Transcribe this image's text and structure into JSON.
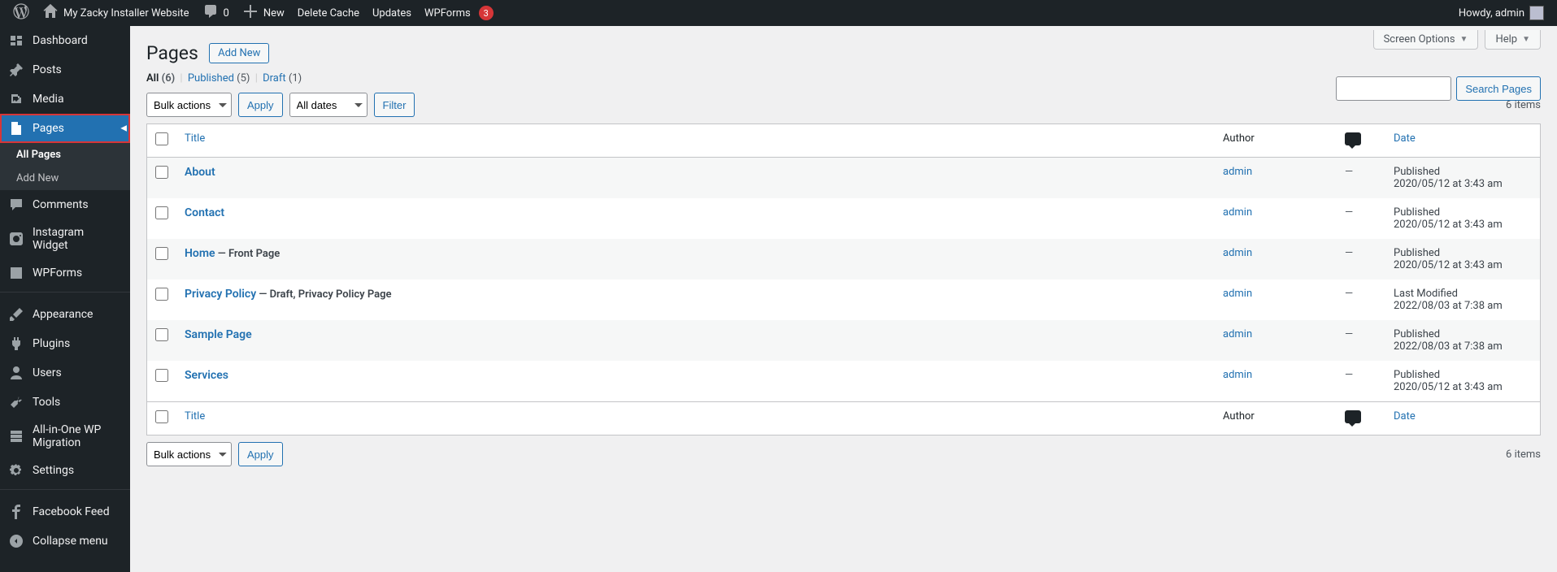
{
  "adminbar": {
    "site_name": "My Zacky Installer Website",
    "comments_count": "0",
    "new_label": "New",
    "delete_cache": "Delete Cache",
    "updates": "Updates",
    "wpforms": "WPForms",
    "wpforms_badge": "3",
    "howdy": "Howdy, admin"
  },
  "sidebar": {
    "items": [
      {
        "label": "Dashboard",
        "icon": "dashboard"
      },
      {
        "label": "Posts",
        "icon": "pin"
      },
      {
        "label": "Media",
        "icon": "media"
      },
      {
        "label": "Pages",
        "icon": "page",
        "current": true
      },
      {
        "label": "Comments",
        "icon": "comment"
      },
      {
        "label": "Instagram Widget",
        "icon": "instagram"
      },
      {
        "label": "WPForms",
        "icon": "wpforms"
      },
      {
        "label": "Appearance",
        "icon": "brush"
      },
      {
        "label": "Plugins",
        "icon": "plugin"
      },
      {
        "label": "Users",
        "icon": "user"
      },
      {
        "label": "Tools",
        "icon": "tools"
      },
      {
        "label": "All-in-One WP Migration",
        "icon": "migration"
      },
      {
        "label": "Settings",
        "icon": "settings"
      },
      {
        "label": "Facebook Feed",
        "icon": "facebook"
      },
      {
        "label": "Collapse menu",
        "icon": "collapse"
      }
    ],
    "submenu": [
      {
        "label": "All Pages",
        "current": true
      },
      {
        "label": "Add New"
      }
    ]
  },
  "header": {
    "title": "Pages",
    "add_new": "Add New",
    "screen_options": "Screen Options",
    "help": "Help"
  },
  "filters": {
    "all_label": "All",
    "all_count": "(6)",
    "published_label": "Published",
    "published_count": "(5)",
    "draft_label": "Draft",
    "draft_count": "(1)"
  },
  "search": {
    "button": "Search Pages"
  },
  "tablenav": {
    "bulk": "Bulk actions",
    "apply": "Apply",
    "dates": "All dates",
    "filter": "Filter",
    "items_count": "6 items"
  },
  "columns": {
    "title": "Title",
    "author": "Author",
    "date": "Date"
  },
  "rows": [
    {
      "title": "About",
      "state": "",
      "author": "admin",
      "comments": "—",
      "date_label": "Published",
      "date": "2020/05/12 at 3:43 am"
    },
    {
      "title": "Contact",
      "state": "",
      "author": "admin",
      "comments": "—",
      "date_label": "Published",
      "date": "2020/05/12 at 3:43 am"
    },
    {
      "title": "Home",
      "state": " — Front Page",
      "author": "admin",
      "comments": "—",
      "date_label": "Published",
      "date": "2020/05/12 at 3:43 am"
    },
    {
      "title": "Privacy Policy",
      "state": " — Draft, Privacy Policy Page",
      "author": "admin",
      "comments": "—",
      "date_label": "Last Modified",
      "date": "2022/08/03 at 7:38 am"
    },
    {
      "title": "Sample Page",
      "state": "",
      "author": "admin",
      "comments": "—",
      "date_label": "Published",
      "date": "2022/08/03 at 7:38 am"
    },
    {
      "title": "Services",
      "state": "",
      "author": "admin",
      "comments": "—",
      "date_label": "Published",
      "date": "2020/05/12 at 3:43 am"
    }
  ]
}
